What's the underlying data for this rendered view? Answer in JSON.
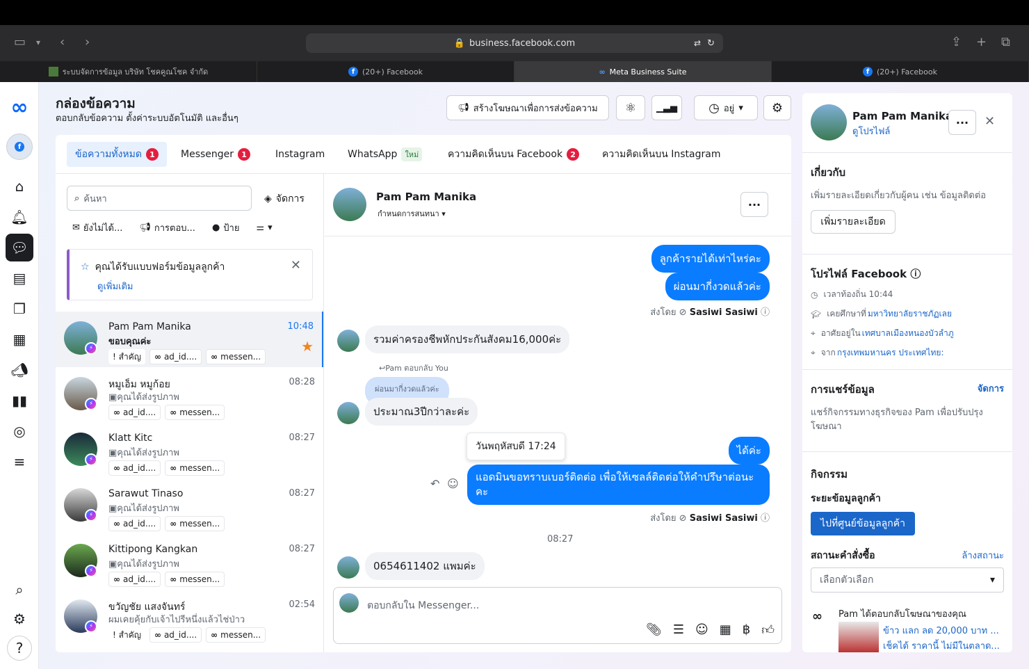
{
  "browser": {
    "url": "business.facebook.com"
  },
  "tabs": [
    {
      "label": "ระบบจัดการข้อมูล บริษัท โชคคูณโชค จำกัด"
    },
    {
      "label": "(20+) Facebook"
    },
    {
      "label": "Meta Business Suite"
    },
    {
      "label": "(20+) Facebook"
    }
  ],
  "header": {
    "title": "กล่องข้อความ",
    "subtitle": "ตอบกลับข้อความ ตั้งค่าระบบอัตโนมัติ และอื่นๆ",
    "ad_button": "สร้างโฆษณาเพื่อการส่งข้อความ",
    "status_label": "อยู่"
  },
  "inbox_tabs": [
    {
      "label": "ข้อความทั้งหมด",
      "badge": "1"
    },
    {
      "label": "Messenger",
      "badge": "1"
    },
    {
      "label": "Instagram"
    },
    {
      "label": "WhatsApp",
      "new": "ใหม่"
    },
    {
      "label": "ความคิดเห็นบน Facebook",
      "badge": "2"
    },
    {
      "label": "ความคิดเห็นบน Instagram"
    }
  ],
  "list": {
    "search_placeholder": "ค้นหา",
    "manage": "จัดการ",
    "filters": [
      "ยังไม่ได้...",
      "การตอบ...",
      "ป้าย"
    ],
    "notice_title": "คุณได้รับแบบฟอร์มข้อมูลลูกค้า",
    "notice_link": "ดูเพิ่มเติม",
    "conversations": [
      {
        "name": "Pam Pam Manika",
        "time": "10:48",
        "preview": "ขอบคุณค่ะ",
        "tags": [
          "! สำคัญ",
          "ad_id....",
          "messen..."
        ]
      },
      {
        "name": "หมูเอ็ม หมูก้อย",
        "time": "08:28",
        "preview": "คุณได้ส่งรูปภาพ",
        "tags": [
          "ad_id....",
          "messen..."
        ]
      },
      {
        "name": "Klatt Kitc",
        "time": "08:27",
        "preview": "คุณได้ส่งรูปภาพ",
        "tags": [
          "ad_id....",
          "messen..."
        ]
      },
      {
        "name": "Sarawut Tinaso",
        "time": "08:27",
        "preview": "คุณได้ส่งรูปภาพ",
        "tags": [
          "ad_id....",
          "messen..."
        ]
      },
      {
        "name": "Kittipong Kangkan",
        "time": "08:27",
        "preview": "คุณได้ส่งรูปภาพ",
        "tags": [
          "ad_id....",
          "messen..."
        ]
      },
      {
        "name": "ขวัญชัย แสงจันทร์",
        "time": "02:54",
        "preview": "ผมเคยคุ้ยกับเจ้าไปรีหนึ่งแล้วไช่ป่าว",
        "tags": [
          "! สำคัญ",
          "ad_id....",
          "messen..."
        ]
      }
    ]
  },
  "chat": {
    "name": "Pam Pam Manika",
    "assign": "กำหนดการสนทนา",
    "messages": {
      "m1": "ลูกค้ารายได้เท่าไหร่คะ",
      "m2": "ผ่อนมากี่งวดแล้วค่ะ",
      "sent_by_1": "ส่งโดย",
      "sender": "Sasiwi Sasiwi",
      "m3": "รวมค่าครองชีพหักประกันสังคม16,000ค่ะ",
      "reply_note": "Pam ตอบกลับ You",
      "quoted": "ผ่อนมากี่งวดแล้วค่ะ",
      "m4": "ประมาณ3ปีกว่าละค่ะ",
      "tooltip": "วันพฤหัสบดี 17:24",
      "m5": "ได้ค่ะ",
      "m6a": "แอดมินขอทราบเบอร์ติดต่อ เพื่อให้เซลล์ติดต่อให้คำปรึษาต่อนะ",
      "m6b": "คะ",
      "time_sep": "08:27",
      "m7": "0654611402 แพมค่ะ"
    },
    "composer_placeholder": "ตอบกลับใน Messenger..."
  },
  "profile": {
    "name": "Pam Pam Manika",
    "view_profile": "ดูโปรไฟล์",
    "about_title": "เกี่ยวกับ",
    "about_desc": "เพิ่มรายละเอียดเกี่ยวกับผู้คน เช่น ข้อมูลติดต่อ",
    "add_details": "เพิ่มรายละเอียด",
    "fb_profile_title": "โปรไฟล์ Facebook",
    "local_time": "เวลาท้องถิ่น 10:44",
    "studied_prefix": "เคยศึกษาที่",
    "studied": "มหาวิทยาลัยราชภัฏเลย",
    "lives_prefix": "อาศัยอยู่ใน",
    "lives": "เทศบาลเมืองหนองบัวลำภู",
    "from_prefix": "จาก",
    "from": "กรุงเทพมหานคร ประเทศไทย:",
    "sharing_title": "การแชร์ข้อมูล",
    "sharing_manage": "จัดการ",
    "sharing_desc_1": "แชร์กิจกรรมทางธุรกิจของ Pam เพื่อปรับปรุง",
    "sharing_desc_2": "โฆษณา",
    "activity_title": "กิจกรรม",
    "lead_stage": "ระยะข้อมูลลูกค้า",
    "lead_button": "ไปที่ศูนย์ข้อมูลลูกค้า",
    "order_status": "สถานะคำสั่งซื้อ",
    "clear_status": "ล้างสถานะ",
    "select_placeholder": "เลือกตัวเลือก",
    "ad_reply": "Pam ได้ตอบกลับโฆษณาของคุณ",
    "ad_line1": "ข้าว แลก ลด 20,000 บาท ...",
    "ad_line2": "เช็คได้ ราคานี้ ไม่มีในตลาด..."
  }
}
